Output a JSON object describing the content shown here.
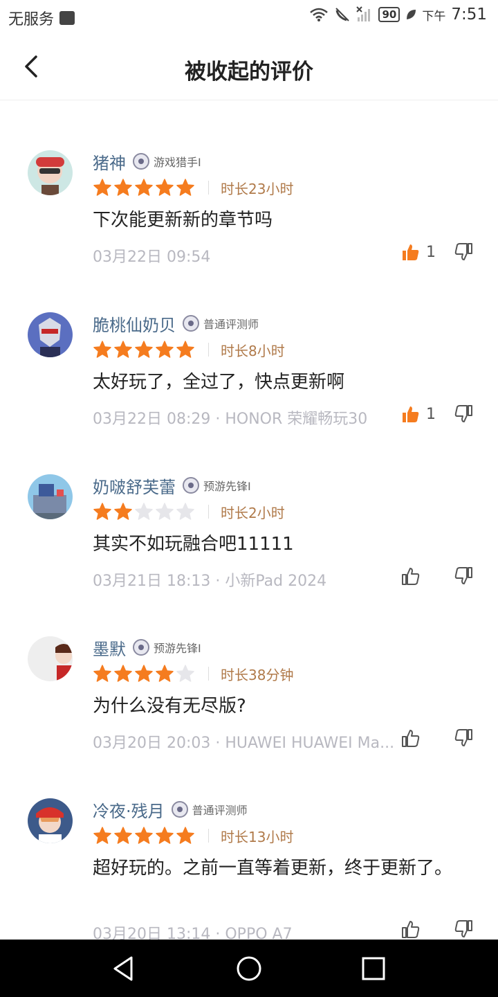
{
  "status_bar": {
    "carrier": "无服务",
    "battery": "90",
    "ampm": "下午",
    "time": "7:51"
  },
  "header": {
    "title": "被收起的评价"
  },
  "reviews": [
    {
      "name": "猪神",
      "badge": "游戏猎手I",
      "rating": 5,
      "playtime": "时长23小时",
      "text": "下次能更新新的章节吗",
      "meta": "03月22日 09:54",
      "likes": "1",
      "liked": true
    },
    {
      "name": "脆桃仙奶贝",
      "badge": "普通评测师",
      "rating": 5,
      "playtime": "时长8小时",
      "text": "太好玩了，全过了，快点更新啊",
      "meta": "03月22日 08:29 · HONOR 荣耀畅玩30",
      "likes": "1",
      "liked": true
    },
    {
      "name": "奶啵舒芙蕾",
      "badge": "预游先锋I",
      "rating": 2,
      "playtime": "时长2小时",
      "text": "其实不如玩融合吧11111",
      "meta": "03月21日 18:13 · 小新Pad 2024",
      "likes": "",
      "liked": false
    },
    {
      "name": "墨默",
      "badge": "预游先锋I",
      "rating": 4,
      "playtime": "时长38分钟",
      "text": "为什么没有无尽版?",
      "meta": "03月20日 20:03 · HUAWEI HUAWEI Ma...",
      "likes": "",
      "liked": false
    },
    {
      "name": "冷夜·残月",
      "badge": "普通评测师",
      "rating": 5,
      "playtime": "时长13小时",
      "text": "超好玩的。之前一直等着更新，终于更新了。",
      "meta": "03月20日 13:14 · OPPO A7",
      "likes": "",
      "liked": false
    }
  ],
  "colors": {
    "star_on": "#f57c1f",
    "star_off": "#e6e6ea",
    "like_active": "#f57c1f",
    "name": "#4a6a8a",
    "playtime": "#b07a4a"
  }
}
